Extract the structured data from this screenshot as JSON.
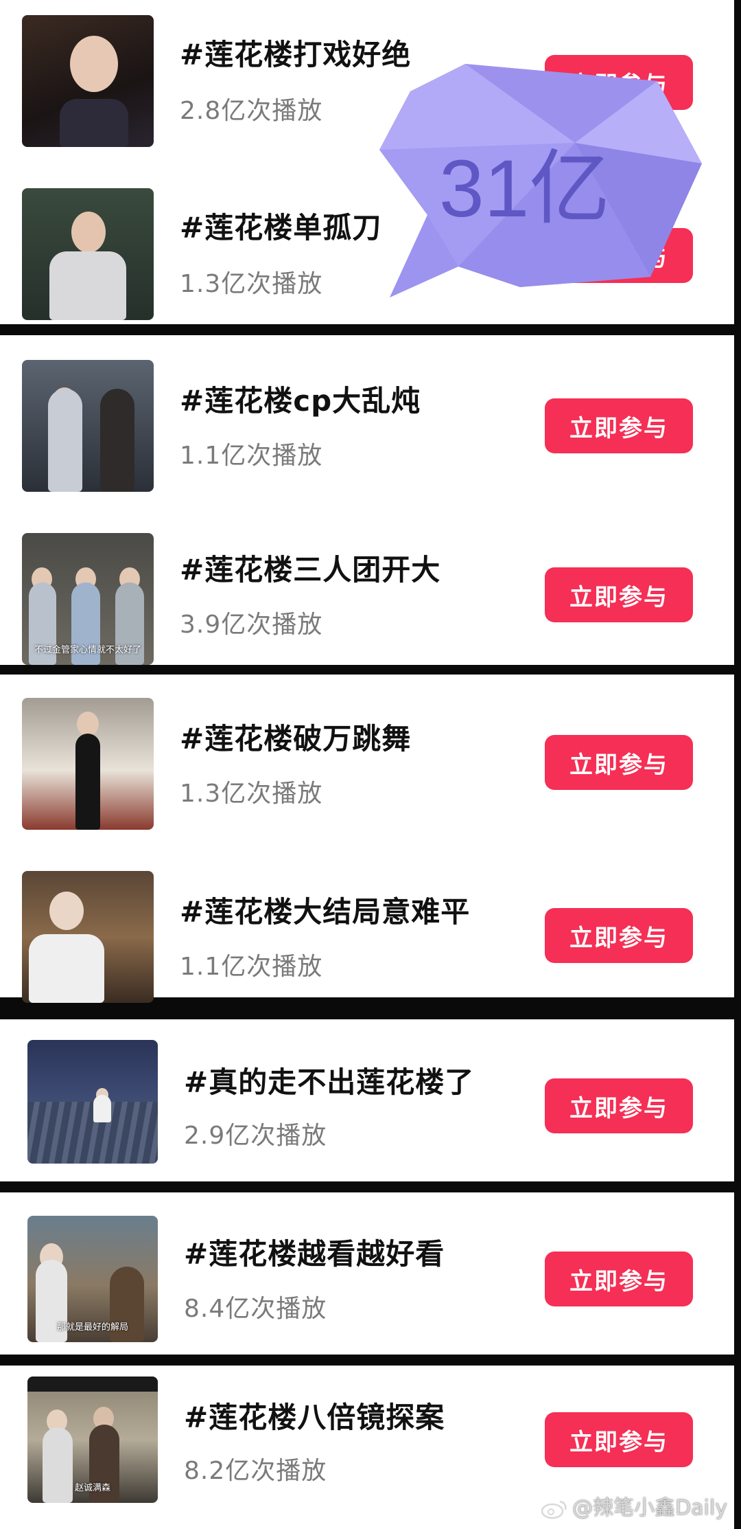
{
  "topics": [
    {
      "title": "#莲花楼打戏好绝",
      "plays": "2.8亿次播放",
      "button": "立即参与"
    },
    {
      "title": "#莲花楼单孤刀",
      "plays": "1.3亿次播放",
      "button": "立即参与"
    },
    {
      "title": "#莲花楼cp大乱炖",
      "plays": "1.1亿次播放",
      "button": "立即参与"
    },
    {
      "title": "#莲花楼三人团开大",
      "plays": "3.9亿次播放",
      "button": "立即参与",
      "thumb_caption": "不过金管家心情就不太好了"
    },
    {
      "title": "#莲花楼破万跳舞",
      "plays": "1.3亿次播放",
      "button": "立即参与"
    },
    {
      "title": "#莲花楼大结局意难平",
      "plays": "1.1亿次播放",
      "button": "立即参与"
    },
    {
      "title": "#真的走不出莲花楼了",
      "plays": "2.9亿次播放",
      "button": "立即参与"
    },
    {
      "title": "#莲花楼越看越好看",
      "plays": "8.4亿次播放",
      "button": "立即参与",
      "thumb_caption": "那就是最好的解局"
    },
    {
      "title": "#莲花楼八倍镜探案",
      "plays": "8.2亿次播放",
      "button": "立即参与",
      "thumb_caption": "赵诚满森"
    }
  ],
  "overlay": {
    "text": "31亿",
    "color": "#a69cf5"
  },
  "watermark": {
    "text": "@辣笔小鑫Daily",
    "icon": "weibo-icon"
  },
  "colors": {
    "button": "#f52f55",
    "title": "#111111",
    "plays": "#7a7a7a"
  }
}
